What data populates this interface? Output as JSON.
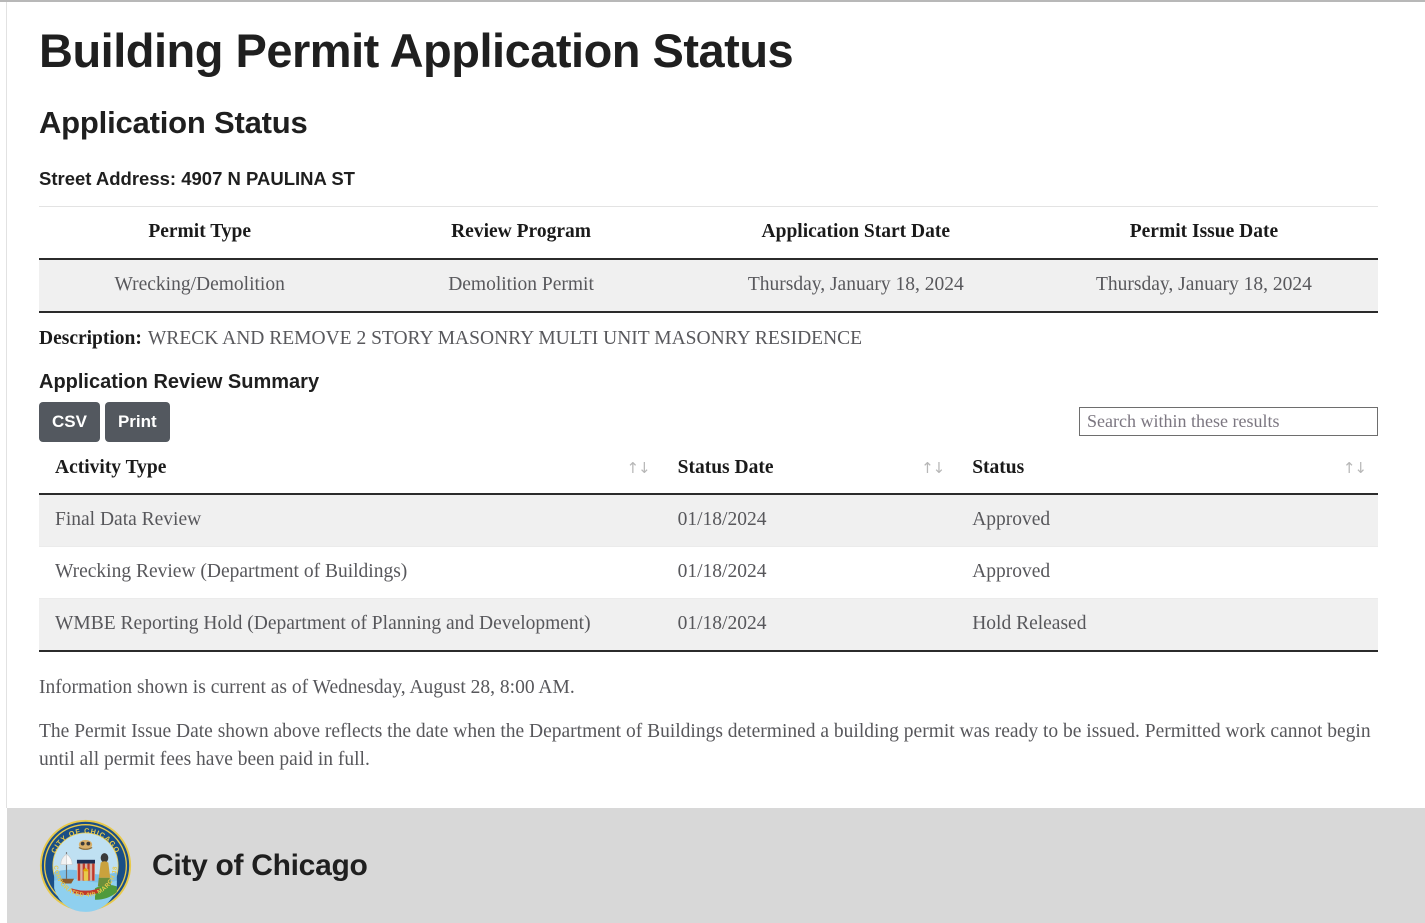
{
  "page": {
    "title": "Building Permit Application Status",
    "section_title": "Application Status",
    "street_address": "Street Address: 4907 N PAULINA ST"
  },
  "permit_table": {
    "headers": [
      "Permit Type",
      "Review Program",
      "Application Start Date",
      "Permit Issue Date"
    ],
    "rows": [
      [
        "Wrecking/Demolition",
        "Demolition Permit",
        "Thursday, January 18, 2024",
        "Thursday, January 18, 2024"
      ]
    ]
  },
  "description": {
    "label": "Description:",
    "text": "WRECK AND REMOVE 2 STORY MASONRY MULTI UNIT MASONRY RESIDENCE"
  },
  "review_summary": {
    "title": "Application Review Summary",
    "csv_label": "CSV",
    "print_label": "Print",
    "search_placeholder": "Search within these results",
    "search_value": "",
    "sort_icon": "↑↓",
    "headers": [
      "Activity Type",
      "Status Date",
      "Status"
    ],
    "rows": [
      [
        "Final Data Review",
        "01/18/2024",
        "Approved"
      ],
      [
        "Wrecking Review (Department of Buildings)",
        "01/18/2024",
        "Approved"
      ],
      [
        "WMBE Reporting Hold (Department of Planning and Development)",
        "01/18/2024",
        "Hold Released"
      ]
    ]
  },
  "notes": {
    "current_as_of": "Information shown is current as of Wednesday, August 28, 8:00 AM.",
    "disclaimer": "The Permit Issue Date shown above reflects the date when the Department of Buildings determined a building permit was ready to be issued. Permitted work cannot begin until all permit fees have been paid in full."
  },
  "footer": {
    "name": "City of Chicago",
    "seal_top_text": "CITY OF CHICAGO",
    "seal_bottom_text": "INCORPORATED 4th MARCH 1837"
  },
  "colors": {
    "button_bg": "#53585f",
    "row_alt_bg": "#f0f0f0",
    "footer_bg": "#d8d8d8",
    "seal_ring": "#1a4f86",
    "seal_gold": "#e8c94a"
  }
}
